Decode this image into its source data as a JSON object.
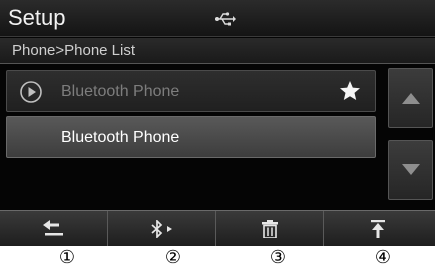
{
  "header": {
    "title": "Setup",
    "status_icon": "usb-icon"
  },
  "breadcrumb": "Phone>Phone List",
  "phone_list": [
    {
      "label": "Bluetooth Phone",
      "state": "connected",
      "icon": "play-circle-icon",
      "favorite": true
    },
    {
      "label": "Bluetooth Phone",
      "state": "selected",
      "icon": null,
      "favorite": false
    }
  ],
  "scroll": {
    "up_icon": "triangle-up-icon",
    "down_icon": "triangle-down-icon"
  },
  "toolbar": [
    {
      "icon": "back-arrow-icon"
    },
    {
      "icon": "bluetooth-connect-icon"
    },
    {
      "icon": "trash-icon"
    },
    {
      "icon": "move-to-top-icon"
    }
  ],
  "callouts": [
    "①",
    "②",
    "③",
    "④"
  ],
  "colors": {
    "background": "#050505",
    "bar": "#2b2b2b",
    "selected_row": "#595959",
    "text": "#ffffff",
    "dim_text": "#7d7d7d"
  }
}
